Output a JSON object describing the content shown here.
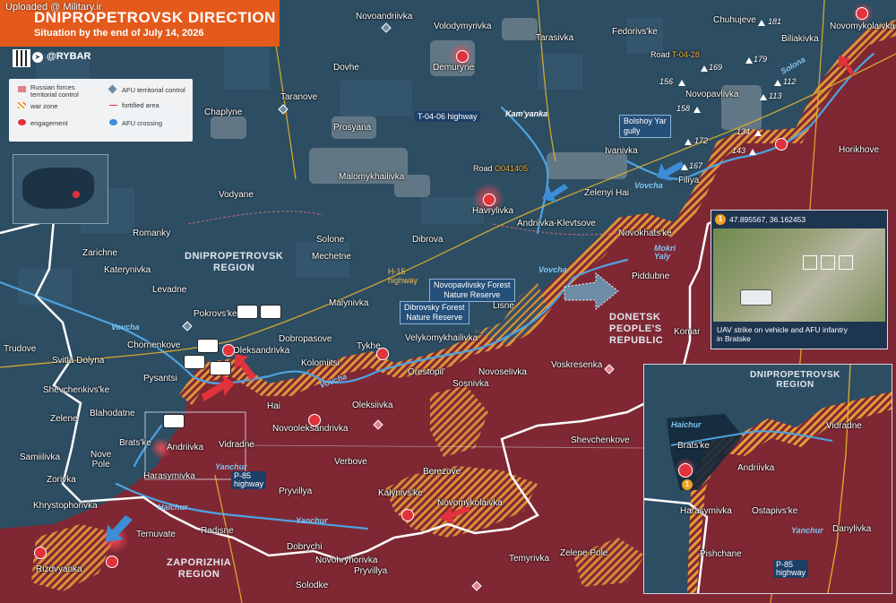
{
  "header": {
    "title": "DNIPROPETROVSK DIRECTION",
    "subtitle": "Situation by the end of July 14, 2026",
    "watermark": "Uploaded @ Military.ir",
    "brand": "@RYBAR"
  },
  "legend": {
    "russian": "Russian forces territorial control",
    "afu": "AFU territorial control",
    "war_zone": "war zone",
    "fortified": "fortified area",
    "engagement": "engagement",
    "crossing": "AFU crossing"
  },
  "colors": {
    "russian": "#7f2834",
    "afu": "#2b4e66",
    "war_zone": "#e59a3a",
    "header": "#e35a1c",
    "engagement": "#e2323c"
  },
  "regions": {
    "dnipro": "DNIPROPETROVSK\nREGION",
    "donetsk": "DONETSK\nPEOPLE'S\nREPUBLIC",
    "zaporizhia": "ZAPORIZHIA\nREGION"
  },
  "places": {
    "novoandriivka": "Novoandriivka",
    "volodymyrivka": "Volodymyrivka",
    "tarasivka": "Tarasivka",
    "fedorivske": "Fedorivs'ke",
    "chuhujeve": "Chuhujeve",
    "biliakivka": "Biliakivka",
    "novomykolaivka_ne": "Novomykolaivka",
    "dovhe": "Dovhe",
    "demuryne": "Demuryne",
    "taranove": "Taranove",
    "chaplyne": "Chaplyne",
    "prosyana": "Prosyana",
    "malomykhailivka": "Malomykhailivka",
    "vodyane": "Vodyane",
    "havrylivka": "Havrylivka",
    "ivanivka": "Ivanivka",
    "novopavlivka": "Novopavlivka",
    "filiya": "Filiya",
    "horikhove": "Horikhove",
    "zelenyi_hai": "Zelenyi Hai",
    "andriivka_klevtsove": "Andriivka-Klevtsove",
    "novokhatske": "Novokhats'ke",
    "romanky": "Romanky",
    "solone": "Solone",
    "dibrova": "Dibrova",
    "mechetne": "Mechetne",
    "zarichne": "Zarichne",
    "katerynivka": "Katerynivka",
    "levadne": "Levadne",
    "pokrovske": "Pokrovs'ke",
    "malynivka": "Malynivka",
    "piddubne": "Piddubne",
    "lisne": "Lisne",
    "chornenkove": "Chornenkove",
    "trudove": "Trudove",
    "svitla_dolyna": "Svitla Dolyna",
    "oleksandrivka": "Oleksandrivka",
    "dobropasove": "Dobropasove",
    "tykhe": "Tykhe",
    "kolomiitsi": "Kolomiitsi",
    "velykomykhailivka": "Velykomykhailivka",
    "komar": "Komar",
    "pysantsi": "Pysantsi",
    "orestopil": "Orestopil'",
    "novoselivka": "Novoselivka",
    "voskresenka": "Voskresenka",
    "shevchenkivske": "Shevchenkivs'ke",
    "sosnivka": "Sosnivka",
    "hai": "Hai",
    "oleksiivka": "Oleksiivka",
    "zelene": "Zelene",
    "blahodatne": "Blahodatne",
    "novooleksandrivka": "Novooleksandrivka",
    "bratske": "Brats'ke",
    "andriivka": "Andriivka",
    "vidradne": "Vidradne",
    "shevchenkove": "Shevchenkove",
    "samiilivka": "Samiilivka",
    "nove_pole": "Nove\nPole",
    "verbove": "Verbove",
    "zorivka": "Zorivka",
    "harasymivka": "Harasymivka",
    "berezove": "Berezove",
    "kalynivske": "Kalynivs'ke",
    "novomykolaivka_s": "Novomykolaivka",
    "khrystophorivka": "Khrystophorivka",
    "pryvillya": "Pryvillya",
    "ternuvate": "Ternuvate",
    "radisne": "Radisne",
    "dobrychi": "Dobrychi",
    "temyrivka": "Temyrivka",
    "zelene_pole": "Zelene Pole",
    "rizdvyanka": "Rizdvyanka",
    "novohryhorivka": "Novohryhorivka",
    "pryvillya2": "Pryvillya",
    "solodke": "Solodke"
  },
  "rivers": {
    "vovcha_w": "Vovcha",
    "vovcha_c": "Vovcha",
    "vovcha_e": "Vovcha",
    "vovcha_ne": "Vovcha",
    "kamyanka": "Kam'yanka",
    "mokri_yaly": "Mokri\nYaly",
    "solona": "Solona",
    "yanchur": "Yanchur",
    "yanchur2": "Yanchur",
    "haichur": "Haichur"
  },
  "roads": {
    "t0406": "T-04-06 highway",
    "o041405_prefix": "Road",
    "o041405": "O041405",
    "t0428_prefix": "Road",
    "t0428": "T-04-28",
    "h15": "H-15\nhighway",
    "p85": "P-85\nhighway"
  },
  "callouts": {
    "bolshoy_yar": "Bolshoy Yar\ngully",
    "novopavlivsky": "Novopavlivsky Forest\nNature Reserve",
    "dibrovsky": "Dibrovsky Forest\nNature Reserve"
  },
  "positions": [
    "181",
    "169",
    "179",
    "156",
    "112",
    "158",
    "113",
    "172",
    "134",
    "143",
    "167"
  ],
  "photo": {
    "coords": "47.895567, 36.162453",
    "caption": "UAV strike on vehicle and AFU infantry\nin Bratske",
    "badge": "1"
  },
  "inset": {
    "region": "DNIPROPETROVSK\nREGION",
    "bratske": "Brats'ke",
    "andriivka": "Andriivka",
    "vidradne": "Vidradne",
    "harasymivka": "Harasymivka",
    "ostapivske": "Ostapivs'ke",
    "danylivka": "Danylivka",
    "pishchane": "Pishchane",
    "haichur": "Haichur",
    "yanchur": "Yanchur",
    "p85": "P-85\nhighway",
    "badge": "1"
  }
}
